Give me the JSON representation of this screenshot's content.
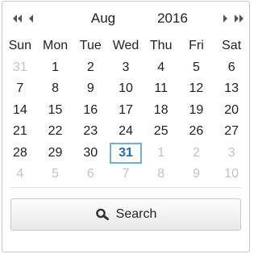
{
  "calendar": {
    "icons": {
      "prev_year": "double-chevron-left-icon",
      "prev_month": "chevron-left-icon",
      "next_month": "chevron-right-icon",
      "next_year": "double-chevron-right-icon",
      "search": "search-icon"
    },
    "month": "Aug",
    "year": "2016",
    "weekdays": [
      "Sun",
      "Mon",
      "Tue",
      "Wed",
      "Thu",
      "Fri",
      "Sat"
    ],
    "weeks": [
      [
        {
          "d": "31",
          "other": true
        },
        {
          "d": "1"
        },
        {
          "d": "2"
        },
        {
          "d": "3"
        },
        {
          "d": "4"
        },
        {
          "d": "5"
        },
        {
          "d": "6"
        }
      ],
      [
        {
          "d": "7"
        },
        {
          "d": "8"
        },
        {
          "d": "9"
        },
        {
          "d": "10"
        },
        {
          "d": "11"
        },
        {
          "d": "12"
        },
        {
          "d": "13"
        }
      ],
      [
        {
          "d": "14"
        },
        {
          "d": "15"
        },
        {
          "d": "16"
        },
        {
          "d": "17"
        },
        {
          "d": "18"
        },
        {
          "d": "19"
        },
        {
          "d": "20"
        }
      ],
      [
        {
          "d": "21"
        },
        {
          "d": "22"
        },
        {
          "d": "23"
        },
        {
          "d": "24"
        },
        {
          "d": "25"
        },
        {
          "d": "26"
        },
        {
          "d": "27"
        }
      ],
      [
        {
          "d": "28"
        },
        {
          "d": "29"
        },
        {
          "d": "30"
        },
        {
          "d": "31",
          "selected": true
        },
        {
          "d": "1",
          "other": true
        },
        {
          "d": "2",
          "other": true
        },
        {
          "d": "3",
          "other": true
        }
      ],
      [
        {
          "d": "4",
          "other": true
        },
        {
          "d": "5",
          "other": true
        },
        {
          "d": "6",
          "other": true
        },
        {
          "d": "7",
          "other": true
        },
        {
          "d": "8",
          "other": true
        },
        {
          "d": "9",
          "other": true
        },
        {
          "d": "10",
          "other": true
        }
      ]
    ],
    "search_label": "Search",
    "colors": {
      "selected_border": "#6fb0d9",
      "selected_text": "#1a6fb5",
      "other_month_text": "#c2c2c2"
    }
  }
}
